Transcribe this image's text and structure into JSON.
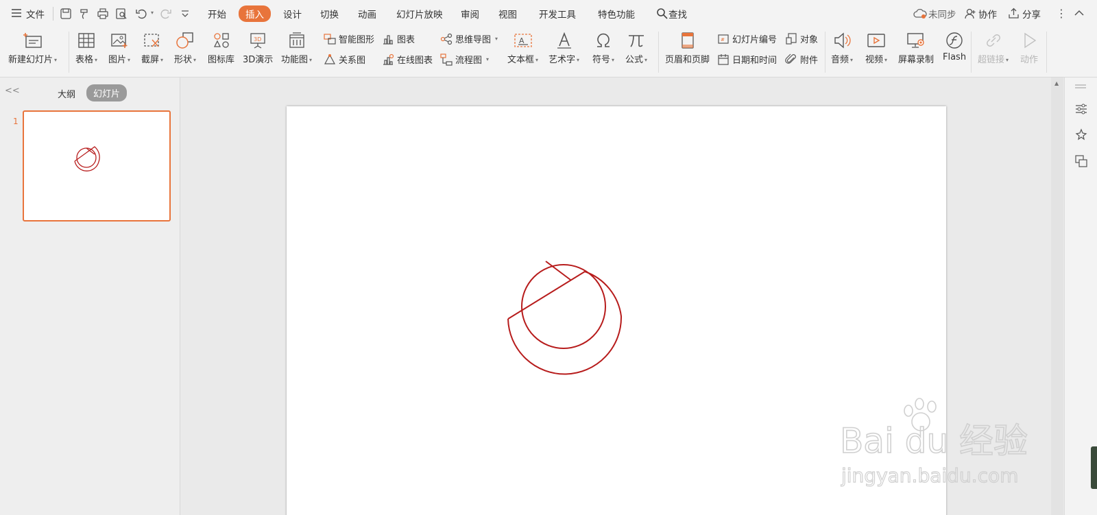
{
  "menu": {
    "file": "文件",
    "tabs": [
      "开始",
      "插入",
      "设计",
      "切换",
      "动画",
      "幻灯片放映",
      "审阅",
      "视图",
      "开发工具",
      "特色功能"
    ],
    "active_tab": "插入",
    "search": "查找",
    "sync": "未同步",
    "collab": "协作",
    "share": "分享"
  },
  "ribbon": {
    "new_slide": "新建幻灯片",
    "table": "表格",
    "picture": "图片",
    "screenshot": "截屏",
    "shape": "形状",
    "icon_lib": "图标库",
    "demo3d": "3D演示",
    "func_chart": "功能图",
    "smart_art": "智能图形",
    "chart": "图表",
    "mind_map": "思维导图",
    "relation": "关系图",
    "online_chart": "在线图表",
    "flowchart": "流程图",
    "textbox": "文本框",
    "wordart": "艺术字",
    "symbol": "符号",
    "formula": "公式",
    "header_footer": "页眉和页脚",
    "slide_number": "幻灯片编号",
    "object": "对象",
    "date_time": "日期和时间",
    "attachment": "附件",
    "audio": "音频",
    "video": "视频",
    "screen_rec": "屏幕录制",
    "flash": "Flash",
    "hyperlink": "超链接",
    "action": "动作"
  },
  "panel": {
    "outline": "大纲",
    "slides": "幻灯片",
    "slide_number": "1"
  },
  "colors": {
    "accent": "#e8743b",
    "shape_stroke": "#b71c1c"
  },
  "watermark": {
    "brand": "Bai du 经验",
    "url": "jingyan.baidu.com"
  }
}
